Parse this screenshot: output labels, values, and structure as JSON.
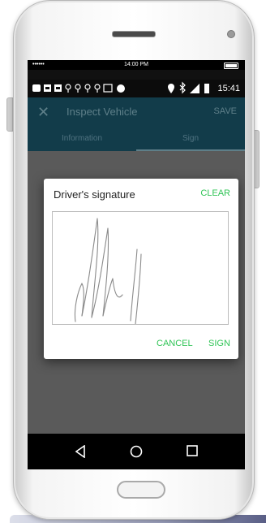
{
  "device": {
    "status_top": {
      "signal": "••••••",
      "time": "14:00 PM"
    },
    "status_android": {
      "time": "15:41"
    }
  },
  "appbar": {
    "title": "Inspect Vehicle",
    "save_label": "SAVE"
  },
  "tabs": [
    {
      "label": "Information",
      "selected": false
    },
    {
      "label": "Sign",
      "selected": true
    }
  ],
  "dialog": {
    "title": "Driver's signature",
    "clear_label": "CLEAR",
    "cancel_label": "CANCEL",
    "sign_label": "SIGN"
  },
  "colors": {
    "appbar": "#123c4a",
    "accent_green": "#2fc455",
    "overlay_gray": "#5a5a5a"
  },
  "icons": [
    "close-icon",
    "back-icon",
    "home-icon",
    "recents-icon"
  ]
}
